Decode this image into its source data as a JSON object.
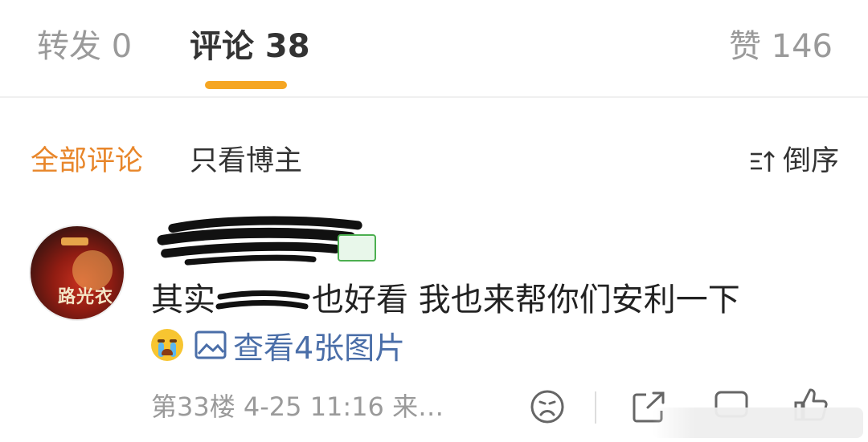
{
  "tabs": {
    "forward": "转发 0",
    "comments": "评论 38",
    "likes": "赞 146"
  },
  "filters": {
    "all": "全部评论",
    "author_only": "只看博主",
    "sort": "倒序"
  },
  "comment": {
    "text_before": "其实",
    "text_after": "也好看 我也来帮你们安利一下",
    "media_link": "查看4张图片",
    "meta": "第33楼 4-25 11:16 来…",
    "avatar_caption": "路光衣"
  },
  "colors": {
    "accent": "#f5a623",
    "link": "#4a6ea8",
    "muted": "#9a9a9a"
  }
}
